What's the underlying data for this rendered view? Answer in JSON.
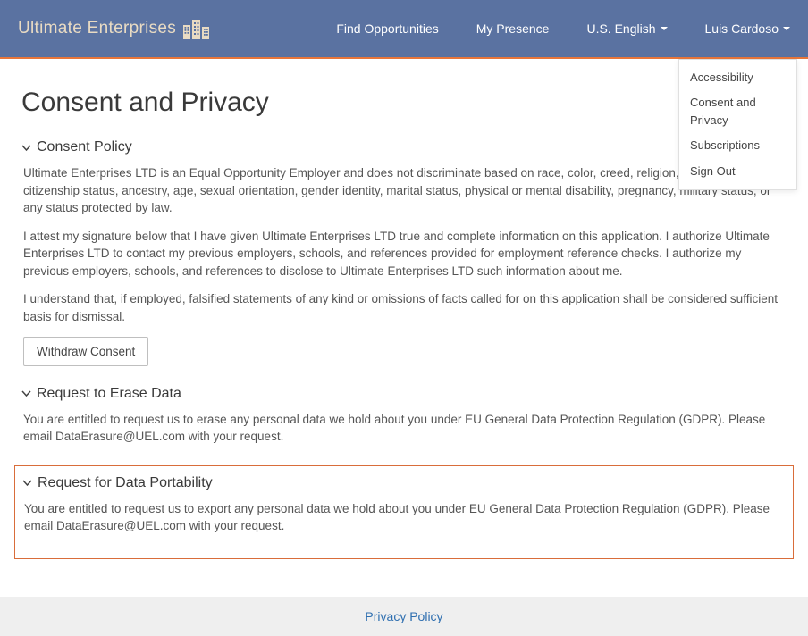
{
  "brand": {
    "name": "Ultimate Enterprises"
  },
  "nav": {
    "find_opportunities": "Find Opportunities",
    "my_presence": "My Presence",
    "language": "U.S. English",
    "user": "Luis Cardoso"
  },
  "user_menu": {
    "items": [
      {
        "label": "Accessibility"
      },
      {
        "label": "Consent and Privacy"
      },
      {
        "label": "Subscriptions"
      },
      {
        "label": "Sign Out"
      }
    ]
  },
  "page": {
    "title": "Consent and Privacy"
  },
  "sections": {
    "consent_policy": {
      "title": "Consent Policy",
      "p1": "Ultimate Enterprises LTD is an Equal Opportunity Employer and does not discriminate based on race, color, creed, religion, national origin, citizenship status, ancestry, age, sexual orientation, gender identity, marital status, physical or mental disability, pregnancy, military status, or any status protected by law.",
      "p2": "I attest my signature below that I have given Ultimate Enterprises LTD true and complete information on this application. I authorize Ultimate Enterprises LTD to contact my previous employers, schools, and references provided for employment reference checks. I authorize my previous employers, schools, and references to disclose to Ultimate Enterprises LTD such information about me.",
      "p3": "I understand that, if employed, falsified statements of any kind or omissions of facts called for on this application shall be considered sufficient basis for dismissal.",
      "withdraw_btn": "Withdraw Consent"
    },
    "erase_data": {
      "title": "Request to Erase Data",
      "body": "You are entitled to request us to erase any personal data we hold about you under EU General Data Protection Regulation (GDPR). Please email DataErasure@UEL.com with your request."
    },
    "portability": {
      "title": "Request for Data Portability",
      "body": "You are entitled to request us to export any personal data we hold about you under EU General Data Protection Regulation (GDPR). Please email DataErasure@UEL.com with your request."
    }
  },
  "footer": {
    "privacy_link": "Privacy Policy"
  }
}
